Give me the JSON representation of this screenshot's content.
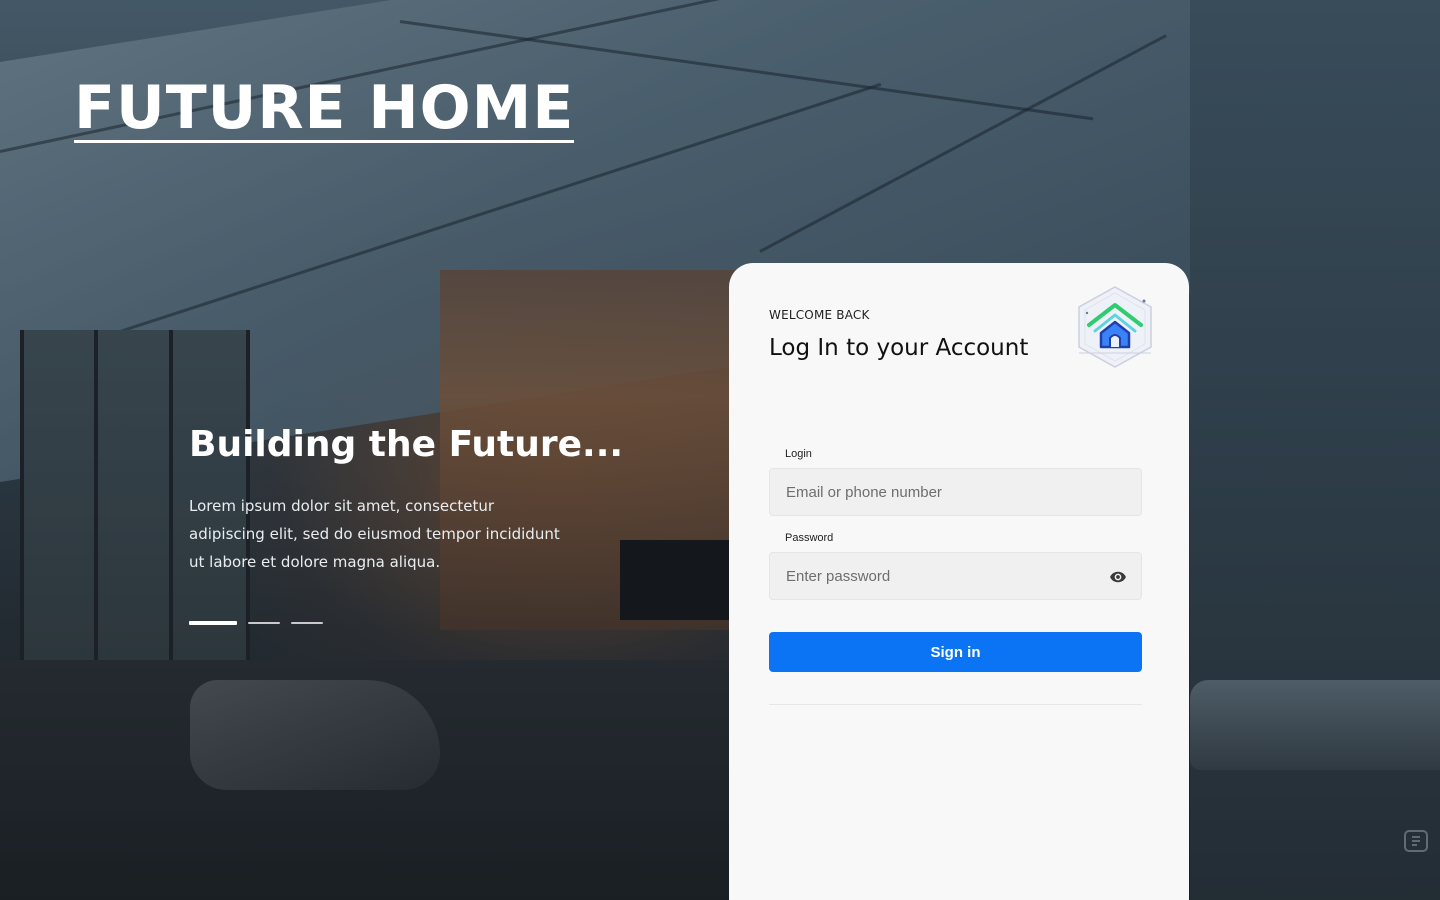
{
  "brand": {
    "name": "FUTURE HOME"
  },
  "hero": {
    "title": "Building the Future...",
    "text": "Lorem ipsum dolor sit amet, consectetur adipiscing elit, sed do eiusmod tempor incididunt ut labore et dolore magna aliqua.",
    "slides": {
      "count": 3,
      "active_index": 0
    }
  },
  "login_card": {
    "eyebrow": "WELCOME BACK",
    "title": "Log In to your Account",
    "logo_icon": "smart-home-logo-icon",
    "login_field": {
      "label": "Login",
      "placeholder": "Email or phone number",
      "value": ""
    },
    "password_field": {
      "label": "Password",
      "placeholder": "Enter password",
      "value": "",
      "toggle_icon": "eye-icon"
    },
    "submit_label": "Sign in"
  },
  "colors": {
    "primary_button": "#0a74f5",
    "card_background": "#f8f8f8",
    "field_background": "#f0f0f0",
    "text_white": "#ffffff"
  }
}
